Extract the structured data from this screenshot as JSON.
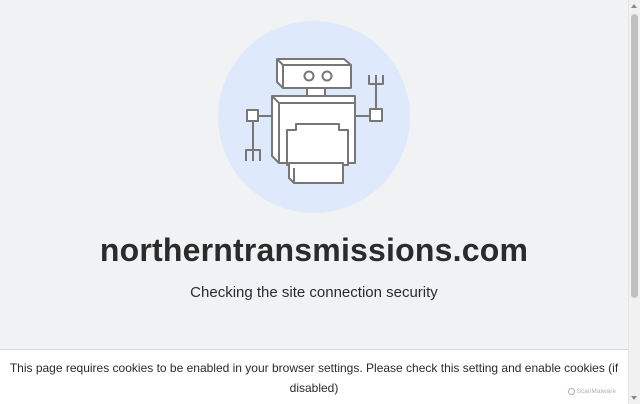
{
  "site": {
    "domain": "northerntransmissions.com",
    "status": "Checking the site connection security"
  },
  "cookie_notice": {
    "text": "This page requires cookies to be enabled in your browser settings. Please check this setting and enable cookies (if disabled)"
  },
  "branding": {
    "name": "ScanMalware"
  },
  "illustration": {
    "icon": "robot-icon",
    "circle_color": "#deeafb",
    "stroke_color": "#777777"
  }
}
